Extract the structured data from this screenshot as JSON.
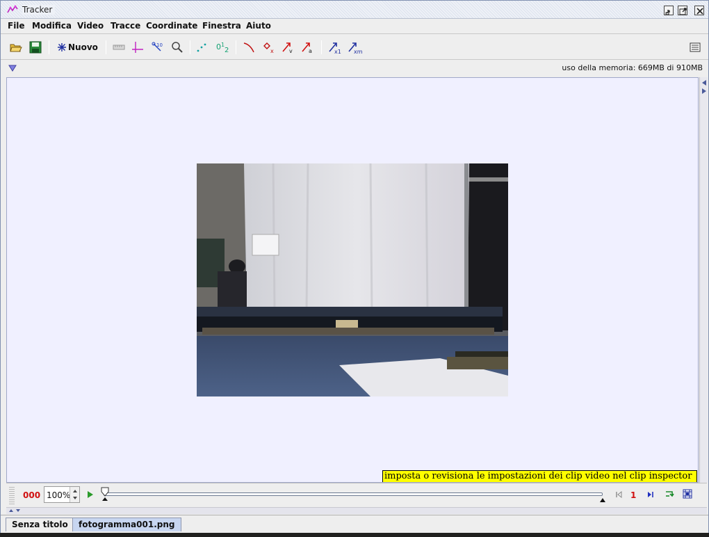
{
  "window": {
    "title": "Tracker",
    "title_icon": "tracker-logo-icon",
    "controls": [
      "minimize-icon",
      "maximize-icon",
      "close-icon"
    ]
  },
  "menubar": {
    "items": [
      "File",
      "Modifica",
      "Video",
      "Tracce",
      "Coordinate",
      "Finestra",
      "Aiuto"
    ]
  },
  "toolbar": {
    "open_icon": "folder-open-icon",
    "save_icon": "save-icon",
    "new_label": "Nuovo",
    "tools": [
      "calibration-tape-icon",
      "axes-icon",
      "calibration-points-icon",
      "zoom-icon",
      "track-trail-icon",
      "track-labels-icon",
      "track-path-icon",
      "position-vector-icon",
      "velocity-vector-icon",
      "acceleration-vector-icon",
      "center-of-mass-x1-icon",
      "center-of-mass-xm-icon"
    ],
    "notes_icon": "notes-icon"
  },
  "infobar": {
    "memory_text": "uso della memoria: 669MB di 910MB"
  },
  "canvas": {
    "background": "#f0f0ff",
    "tooltip": "imposta o revisiona le impostazioni dei clip video nel clip inspector"
  },
  "player": {
    "frame_counter": "000",
    "zoom": "100%",
    "frame_number": "1",
    "colors": {
      "counter": "#d01010",
      "play": "#2a9a2a"
    }
  },
  "tabs": [
    {
      "label": "Senza titolo",
      "active": false
    },
    {
      "label": "fotogramma001.png",
      "active": true
    }
  ]
}
